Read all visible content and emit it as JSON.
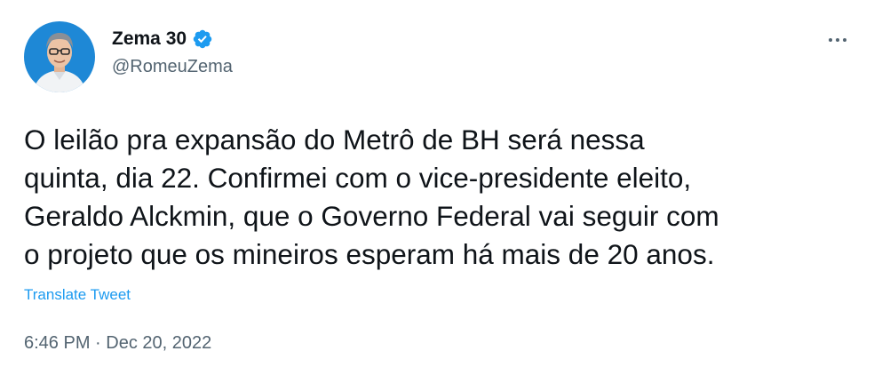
{
  "author": {
    "display_name": "Zema 30",
    "handle": "@RomeuZema",
    "avatar_icon": "profile-photo-avatar",
    "verified_icon": "verified-badge-icon"
  },
  "menu": {
    "icon": "more-options-icon"
  },
  "tweet": {
    "text": "O leilão pra expansão do Metrô de BH será nessa\nquinta, dia 22. Confirmei com o vice-presidente eleito,\nGeraldo Alckmin, que o Governo Federal vai seguir com\no projeto que os mineiros esperam há mais de 20 anos.",
    "translate_label": "Translate Tweet",
    "timestamp": "6:46 PM · Dec 20, 2022"
  },
  "colors": {
    "text_primary": "#0f1419",
    "text_secondary": "#536471",
    "link": "#1d9bf0",
    "verified": "#1d9bf0",
    "avatar_background": "#1e88d6"
  }
}
